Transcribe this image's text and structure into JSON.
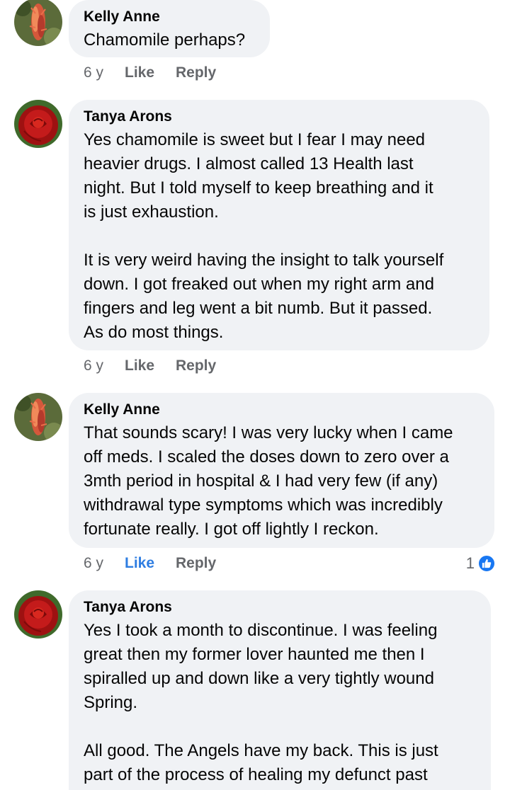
{
  "comments": [
    {
      "author": "Kelly Anne",
      "paragraphs": [
        "Chamomile perhaps?"
      ],
      "time": "6 y",
      "like_label": "Like",
      "reply_label": "Reply"
    },
    {
      "author": "Tanya Arons",
      "paragraphs": [
        "Yes chamomile is sweet but I fear I may need\nheavier drugs.  I almost called 13 Health last\nnight.  But I told myself to keep breathing and it\nis just exhaustion.",
        "It is very weird having the insight to talk yourself\ndown.  I got freaked out when my right arm and\nfingers and leg went a bit numb.  But it passed.\nAs do most things."
      ],
      "time": "6 y",
      "like_label": "Like",
      "reply_label": "Reply"
    },
    {
      "author": "Kelly Anne",
      "paragraphs": [
        "That sounds scary! I was very lucky when I came\noff meds. I scaled the doses down to zero over a\n3mth period in hospital & I had very few (if any)\nwithdrawal type symptoms which was incredibly\nfortunate really. I got off lightly I reckon."
      ],
      "time": "6 y",
      "like_label": "Like",
      "reply_label": "Reply",
      "reaction_count": "1",
      "reaction_icon": "thumbs-up-icon"
    },
    {
      "author": "Tanya Arons",
      "paragraphs": [
        "Yes I took a month to discontinue.  I was feeling\ngreat then my former lover haunted me then I\nspiralled up and down like a very tightly wound\nSpring.",
        "All good.  The Angels have my back. This is just\npart of the process of healing my defunct past"
      ]
    }
  ],
  "colors": {
    "bubble": "#f0f2f5",
    "meta_text": "#65676b",
    "like_active": "#2e7de1",
    "reaction_badge": "#1877f2"
  }
}
